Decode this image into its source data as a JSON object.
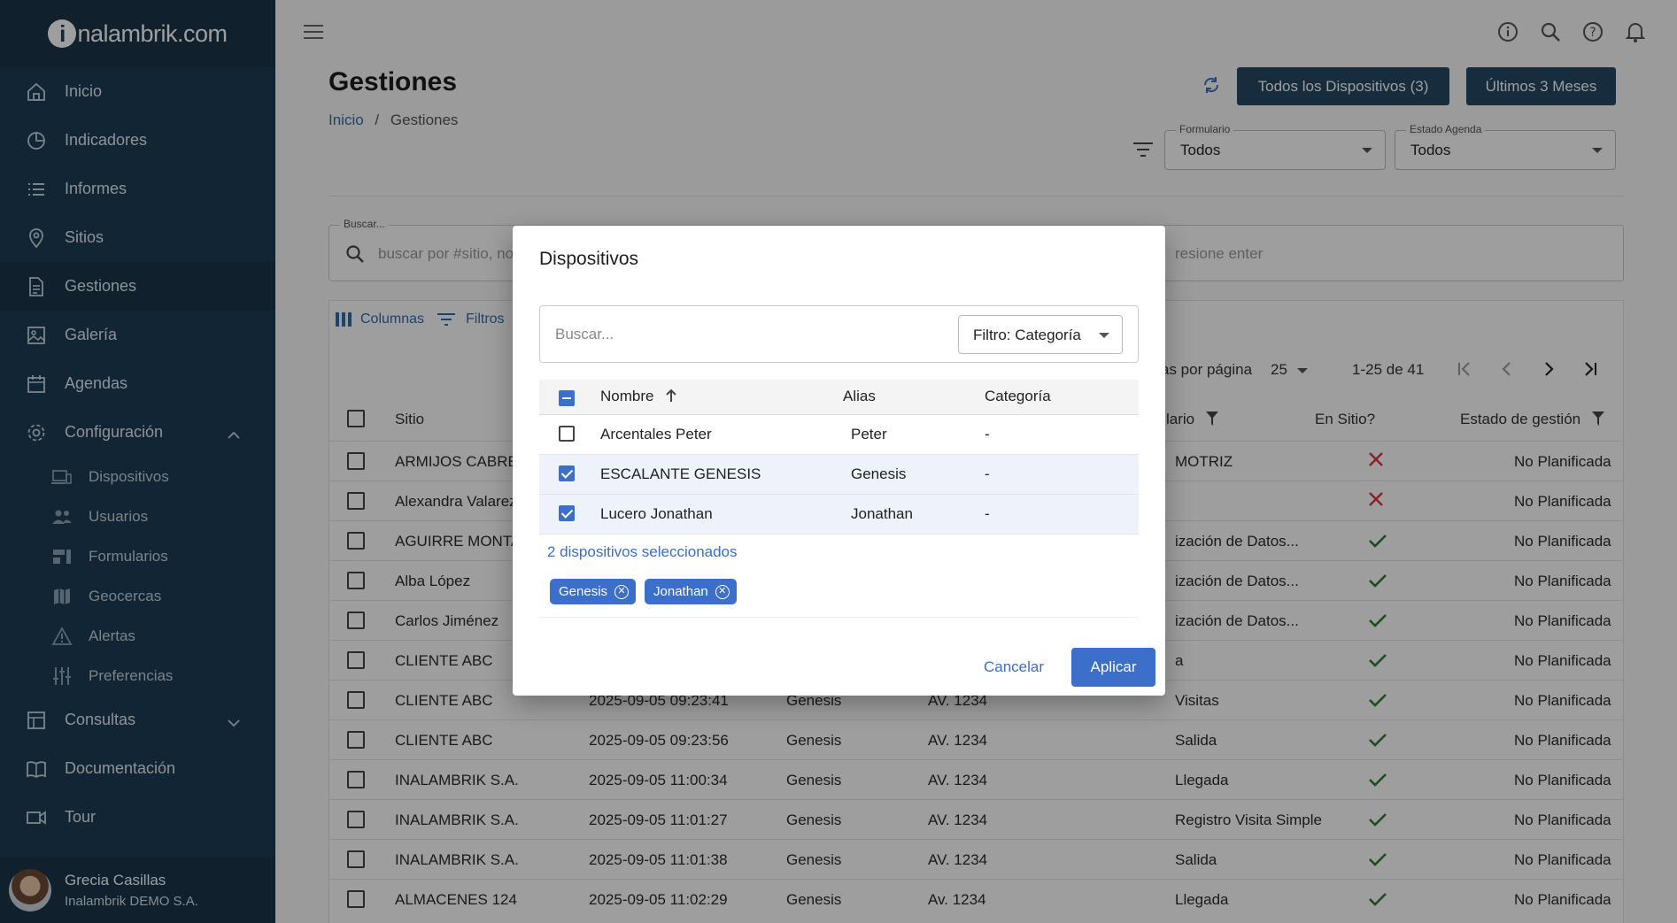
{
  "brand": {
    "prefix": "i",
    "logo_text": "nalambrik.com"
  },
  "nav": [
    {
      "key": "inicio",
      "label": "Inicio",
      "icon": "home-icon"
    },
    {
      "key": "indicadores",
      "label": "Indicadores",
      "icon": "pie-chart-icon"
    },
    {
      "key": "informes",
      "label": "Informes",
      "icon": "list-icon"
    },
    {
      "key": "sitios",
      "label": "Sitios",
      "icon": "location-pin-icon"
    },
    {
      "key": "gestiones",
      "label": "Gestiones",
      "icon": "document-icon",
      "active": true
    },
    {
      "key": "galeria",
      "label": "Galería",
      "icon": "image-icon"
    },
    {
      "key": "agendas",
      "label": "Agendas",
      "icon": "calendar-icon"
    },
    {
      "key": "configuracion",
      "label": "Configuración",
      "icon": "gear-icon",
      "expanded": true
    }
  ],
  "subnav": [
    {
      "key": "dispositivos",
      "label": "Dispositivos",
      "icon": "devices-icon"
    },
    {
      "key": "usuarios",
      "label": "Usuarios",
      "icon": "users-icon"
    },
    {
      "key": "formularios",
      "label": "Formularios",
      "icon": "form-icon"
    },
    {
      "key": "geocercas",
      "label": "Geocercas",
      "icon": "map-icon"
    },
    {
      "key": "alertas",
      "label": "Alertas",
      "icon": "warning-icon"
    },
    {
      "key": "preferencias",
      "label": "Preferencias",
      "icon": "sliders-icon"
    }
  ],
  "nav_bottom": [
    {
      "key": "consultas",
      "label": "Consultas",
      "icon": "table-icon"
    },
    {
      "key": "documentacion",
      "label": "Documentación",
      "icon": "book-icon"
    },
    {
      "key": "tour",
      "label": "Tour",
      "icon": "video-icon"
    }
  ],
  "user": {
    "name": "Grecia Casillas",
    "org": "Inalambrik DEMO S.A."
  },
  "page": {
    "title": "Gestiones",
    "breadcrumb_home": "Inicio",
    "breadcrumb_sep": "/",
    "breadcrumb_current": "Gestiones",
    "devices_button": "Todos los Dispositivos (3)",
    "period_button": "Últimos 3 Meses",
    "form_filter": {
      "label": "Formulario",
      "value": "Todos"
    },
    "agenda_filter": {
      "label": "Estado Agenda",
      "value": "Todos"
    },
    "search": {
      "label": "Buscar...",
      "placeholder": "buscar por #sitio, no",
      "placeholder_tail": "resione enter"
    }
  },
  "grid": {
    "columns_label": "Columnas",
    "filters_label": "Filtros",
    "rows_per_page_label": "as por página",
    "rows_per_page": "25",
    "range": "1-25 de 41",
    "headers": {
      "sitio": "Sitio",
      "formulario": "lario",
      "en_sitio": "En Sitio?",
      "estado": "Estado de gestión"
    },
    "rows": [
      {
        "sitio": "ARMIJOS CABRE",
        "fecha": "",
        "disp": "",
        "dir": "",
        "form": "MOTRIZ",
        "en_sitio": false,
        "estado": "No Planificada"
      },
      {
        "sitio": "Alexandra Valarez",
        "fecha": "",
        "disp": "",
        "dir": "",
        "form": "",
        "en_sitio": false,
        "estado": "No Planificada"
      },
      {
        "sitio": "AGUIRRE MONTA",
        "fecha": "",
        "disp": "",
        "dir": "",
        "form": "ización de Datos...",
        "en_sitio": true,
        "estado": "No Planificada"
      },
      {
        "sitio": "Alba López",
        "fecha": "",
        "disp": "",
        "dir": "",
        "form": "ización de Datos...",
        "en_sitio": true,
        "estado": "No Planificada"
      },
      {
        "sitio": "Carlos Jiménez",
        "fecha": "",
        "disp": "",
        "dir": "",
        "form": "ización de Datos...",
        "en_sitio": true,
        "estado": "No Planificada"
      },
      {
        "sitio": "CLIENTE ABC",
        "fecha": "",
        "disp": "",
        "dir": "",
        "form": "a",
        "en_sitio": true,
        "estado": "No Planificada"
      },
      {
        "sitio": "CLIENTE ABC",
        "fecha": "2025-09-05 09:23:41",
        "disp": "Genesis",
        "dir": "AV. 1234",
        "form": "Visitas",
        "en_sitio": true,
        "estado": "No Planificada"
      },
      {
        "sitio": "CLIENTE ABC",
        "fecha": "2025-09-05 09:23:56",
        "disp": "Genesis",
        "dir": "AV. 1234",
        "form": "Salida",
        "en_sitio": true,
        "estado": "No Planificada"
      },
      {
        "sitio": "INALAMBRIK S.A.",
        "fecha": "2025-09-05 11:00:34",
        "disp": "Genesis",
        "dir": "AV. 1234",
        "form": "Llegada",
        "en_sitio": true,
        "estado": "No Planificada"
      },
      {
        "sitio": "INALAMBRIK S.A.",
        "fecha": "2025-09-05 11:01:27",
        "disp": "Genesis",
        "dir": "AV. 1234",
        "form": "Registro Visita Simple",
        "en_sitio": true,
        "estado": "No Planificada"
      },
      {
        "sitio": "INALAMBRIK S.A.",
        "fecha": "2025-09-05 11:01:38",
        "disp": "Genesis",
        "dir": "AV. 1234",
        "form": "Salida",
        "en_sitio": true,
        "estado": "No Planificada"
      },
      {
        "sitio": "ALMACENES 124",
        "fecha": "2025-09-05 11:02:29",
        "disp": "Genesis",
        "dir": "Av. 1234",
        "form": "Llegada",
        "en_sitio": true,
        "estado": "No Planificada"
      }
    ]
  },
  "modal": {
    "title": "Dispositivos",
    "search_placeholder": "Buscar...",
    "filter_value": "Filtro: Categoría",
    "headers": {
      "nombre": "Nombre",
      "alias": "Alias",
      "categoria": "Categoría"
    },
    "rows": [
      {
        "nombre": "Arcentales Peter",
        "alias": "Peter",
        "categoria": "-",
        "checked": false
      },
      {
        "nombre": "ESCALANTE GENESIS",
        "alias": "Genesis",
        "categoria": "-",
        "checked": true
      },
      {
        "nombre": "Lucero Jonathan",
        "alias": "Jonathan",
        "categoria": "-",
        "checked": true
      }
    ],
    "selected_count": "2 dispositivos seleccionados",
    "chips": [
      "Genesis",
      "Jonathan"
    ],
    "cancel_label": "Cancelar",
    "apply_label": "Aplicar"
  },
  "colors": {
    "sidebar": "#1e3d54",
    "primary": "#3b6fc9",
    "dark_button": "#264a63",
    "error": "#d9363e",
    "success": "#2e7d32"
  }
}
